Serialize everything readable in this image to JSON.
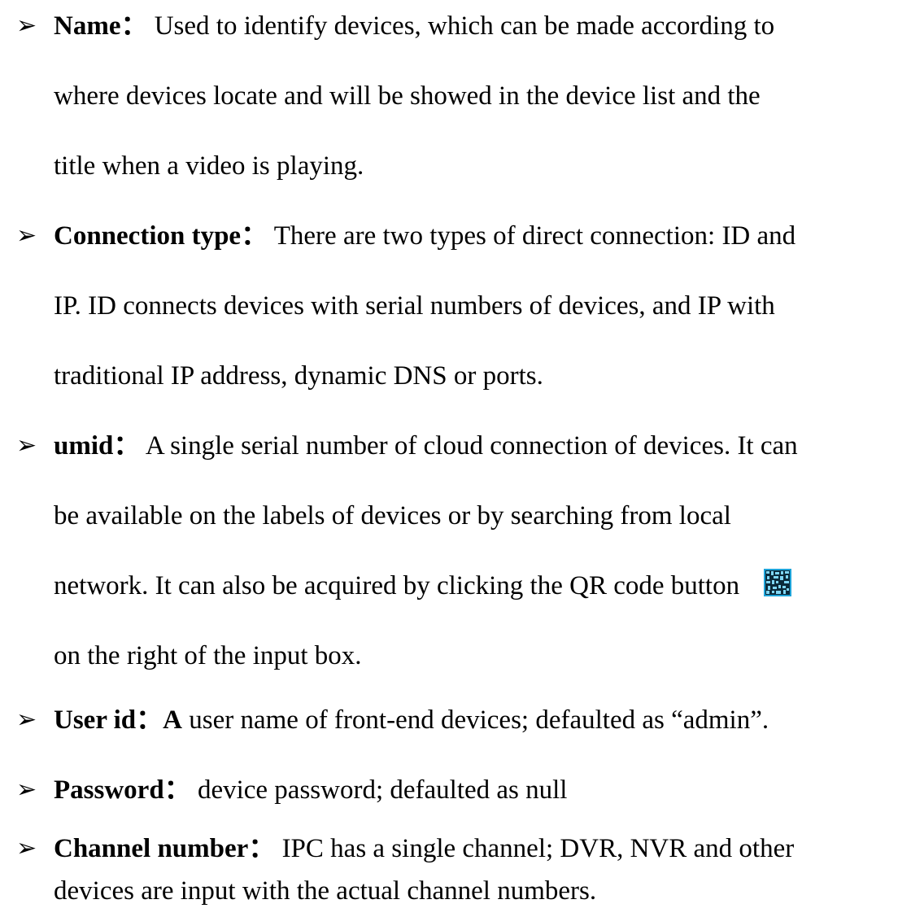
{
  "bullet_glyph": "➢",
  "items": [
    {
      "term": "Name",
      "separator": "：",
      "lines": [
        "Used to identify devices, which can be made according to",
        "where devices locate and will be showed in the device list and the",
        "title when a video is playing."
      ]
    },
    {
      "term": "Connection type",
      "separator": "：",
      "lines": [
        "There are two types of direct connection: ID and",
        "IP. ID connects devices with serial numbers of devices, and IP with",
        "traditional IP address, dynamic DNS or ports."
      ]
    },
    {
      "term": "umid",
      "separator": "：",
      "lines": [
        "A single serial number of cloud connection of devices. It can",
        "be available on the labels of devices or by searching from local",
        "network. It can also be acquired by clicking the QR code button",
        "on the right of the input box."
      ],
      "inline_icon": "qr-code-icon",
      "icon_color": "#1ea3d8"
    },
    {
      "term": "User id",
      "separator": "：",
      "term_suffix": "A",
      "lines": [
        " user name of front-end devices; defaulted as “admin”."
      ]
    },
    {
      "term": "Password",
      "separator": "：",
      "lines": [
        "device password; defaulted as null"
      ]
    },
    {
      "term": "Channel number",
      "separator": "：",
      "lines": [
        "IPC has a single channel; DVR, NVR and other",
        "devices are input with the actual channel numbers."
      ]
    }
  ]
}
